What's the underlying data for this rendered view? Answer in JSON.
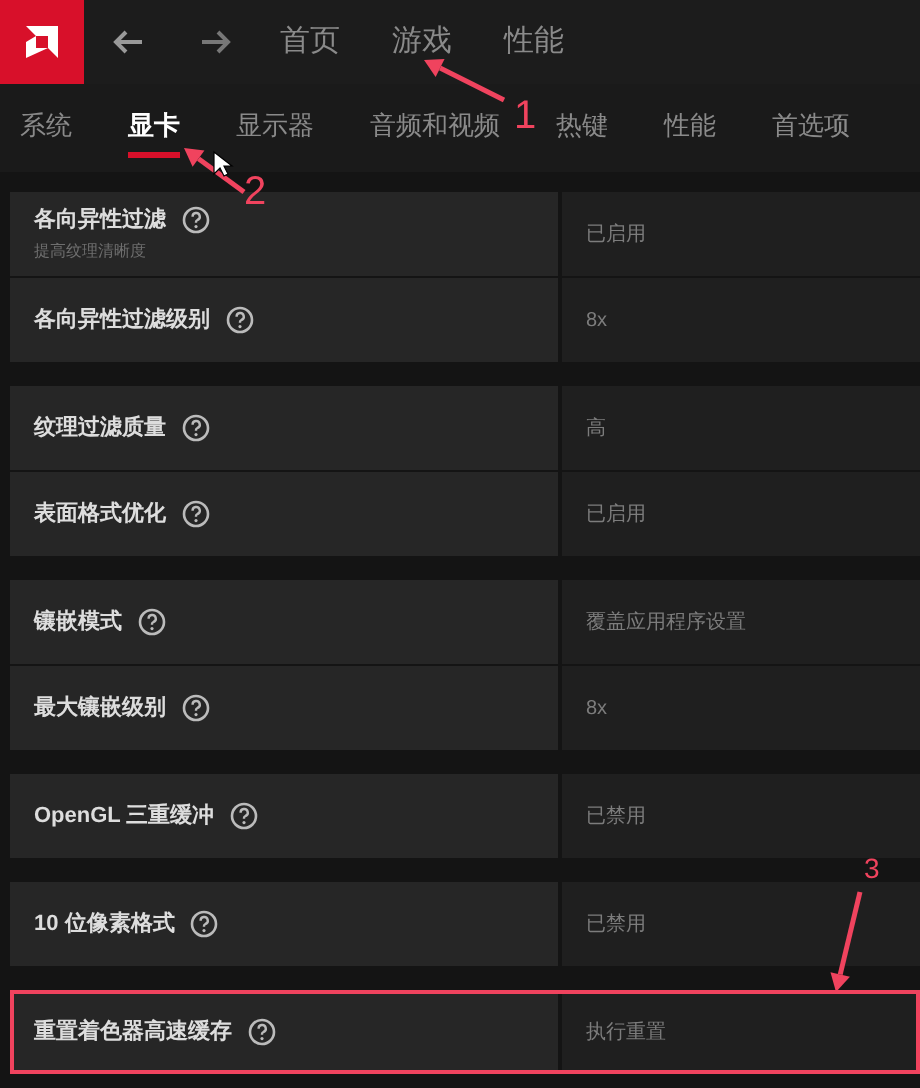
{
  "nav": {
    "items": [
      {
        "label": "首页"
      },
      {
        "label": "游戏"
      },
      {
        "label": "性能"
      }
    ]
  },
  "tabs": [
    {
      "label": "系统",
      "selected": false
    },
    {
      "label": "显卡",
      "selected": true
    },
    {
      "label": "显示器",
      "selected": false
    },
    {
      "label": "音频和视频",
      "selected": false
    },
    {
      "label": "热键",
      "selected": false
    },
    {
      "label": "性能",
      "selected": false
    },
    {
      "label": "首选项",
      "selected": false
    }
  ],
  "groups": [
    {
      "rows": [
        {
          "label": "各向异性过滤",
          "sublabel": "提高纹理清晰度",
          "value": "已启用",
          "highlighted": false
        },
        {
          "label": "各向异性过滤级别",
          "value": "8x",
          "highlighted": false
        }
      ]
    },
    {
      "rows": [
        {
          "label": "纹理过滤质量",
          "value": "高",
          "highlighted": false
        },
        {
          "label": "表面格式优化",
          "value": "已启用",
          "highlighted": false
        }
      ]
    },
    {
      "rows": [
        {
          "label": "镶嵌模式",
          "value": "覆盖应用程序设置",
          "highlighted": false
        },
        {
          "label": "最大镶嵌级别",
          "value": "8x",
          "highlighted": false
        }
      ]
    },
    {
      "rows": [
        {
          "label": "OpenGL 三重缓冲",
          "value": "已禁用",
          "highlighted": false
        }
      ]
    },
    {
      "rows": [
        {
          "label": "10 位像素格式",
          "value": "已禁用",
          "highlighted": false
        }
      ]
    },
    {
      "rows": [
        {
          "label": "重置着色器高速缓存",
          "value": "执行重置",
          "highlighted": true
        }
      ]
    }
  ],
  "annotations": [
    {
      "label": "1"
    },
    {
      "label": "2"
    },
    {
      "label": "3"
    }
  ]
}
